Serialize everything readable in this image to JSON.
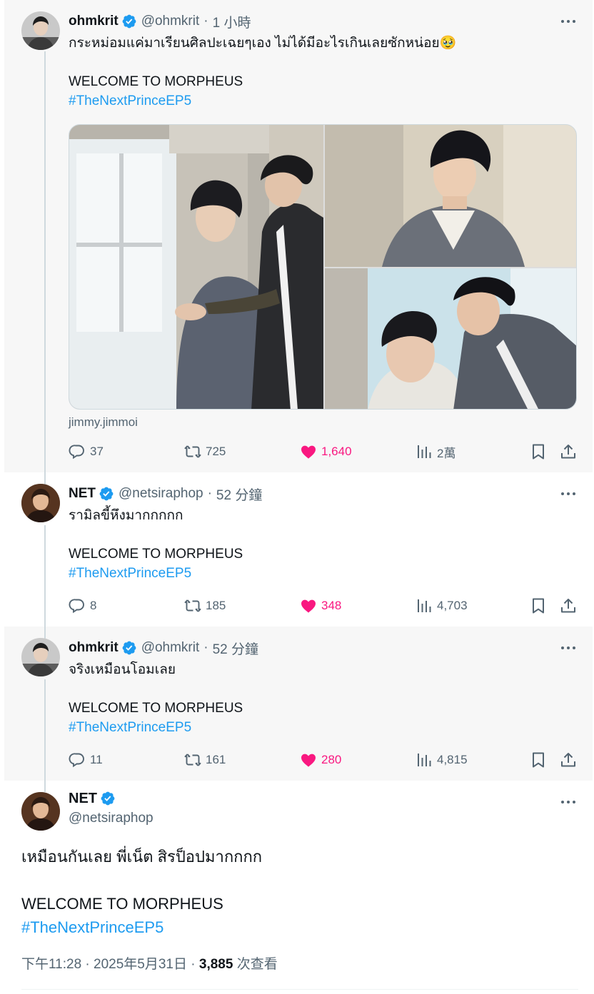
{
  "posts": [
    {
      "author": "ohmkrit",
      "handle": "@ohmkrit",
      "time": "1 小時",
      "line1": "กระหม่อมแค่มาเรียนศิลปะเฉยๆเอง ไม่ได้มีอะไรเกินเลยซักหน่อย🥹",
      "line2": "WELCOME TO MORPHEUS",
      "hashtag": "#TheNextPrinceEP5",
      "credit": "jimmy.jimmoi",
      "replies": "37",
      "reposts": "725",
      "likes": "1,640",
      "views": "2萬"
    },
    {
      "author": "NET",
      "handle": "@netsiraphop",
      "time": "52 分鐘",
      "line1": "รามิลขี้หึงมากกกกก",
      "line2": "WELCOME TO MORPHEUS",
      "hashtag": "#TheNextPrinceEP5",
      "replies": "8",
      "reposts": "185",
      "likes": "348",
      "views": "4,703"
    },
    {
      "author": "ohmkrit",
      "handle": "@ohmkrit",
      "time": "52 分鐘",
      "line1": "จริงเหมือนโอมเลย",
      "line2": "WELCOME TO MORPHEUS",
      "hashtag": "#TheNextPrinceEP5",
      "replies": "11",
      "reposts": "161",
      "likes": "280",
      "views": "4,815"
    }
  ],
  "main": {
    "author": "NET",
    "handle": "@netsiraphop",
    "line1": "เหมือนกันเลย พี่เน็ต สิรป็อปมากกกก",
    "line2": "WELCOME TO MORPHEUS",
    "hashtag": "#TheNextPrinceEP5",
    "timestamp": "下午11:28 · 2025年5月31日 · ",
    "views_count": "3,885",
    "views_label": " 次查看"
  },
  "colors": {
    "accent": "#1d9bf0",
    "like": "#f91880",
    "muted": "#536471",
    "shaded_bg": "#f7f7f7"
  },
  "icons": [
    "verified-badge-icon",
    "more-icon",
    "reply-icon",
    "repost-icon",
    "heart-filled-icon",
    "views-icon",
    "bookmark-icon",
    "share-icon"
  ]
}
